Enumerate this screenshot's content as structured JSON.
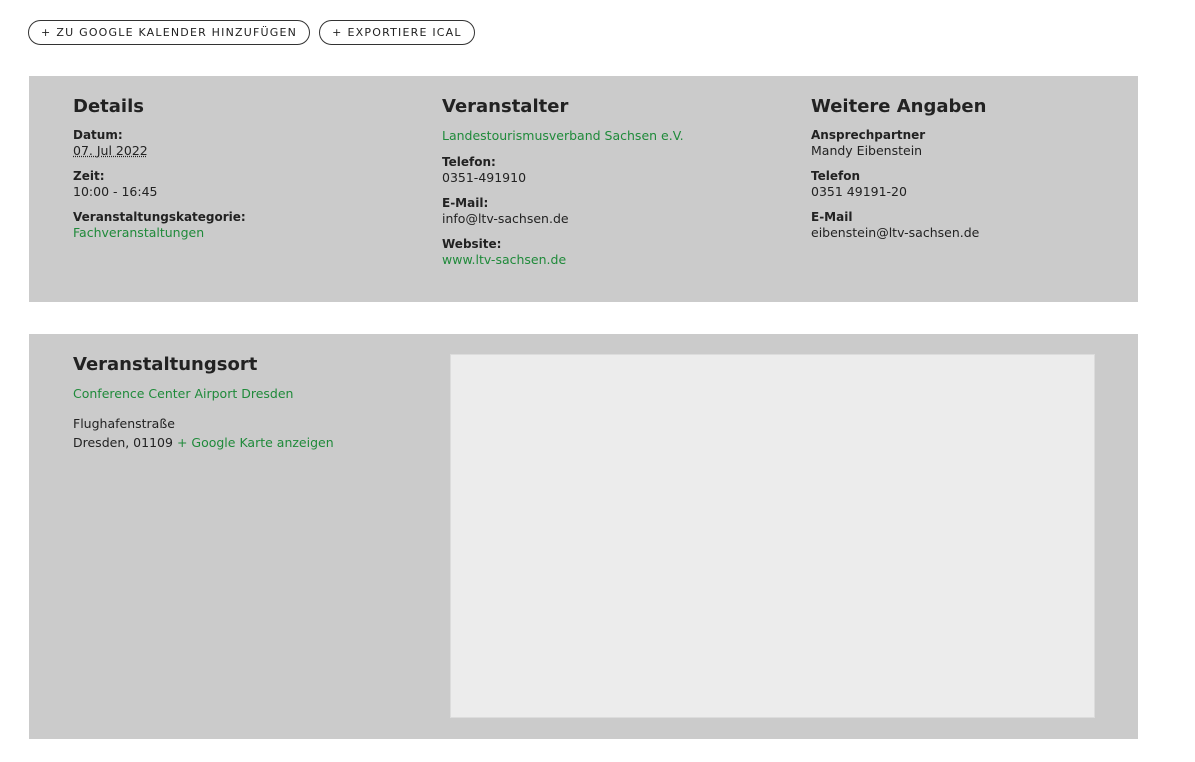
{
  "actions": {
    "google_calendar": "ZU GOOGLE KALENDER HINZUFÜGEN",
    "ical_export": "EXPORTIERE ICAL",
    "plus": "+"
  },
  "details": {
    "heading": "Details",
    "date_label": "Datum:",
    "date_value": "07. Jul 2022",
    "time_label": "Zeit:",
    "time_value": "10:00 - 16:45",
    "category_label": "Veranstaltungskategorie:",
    "category_value": "Fachveranstaltungen"
  },
  "organizer": {
    "heading": "Veranstalter",
    "name": "Landestourismusverband Sachsen e.V.",
    "phone_label": "Telefon:",
    "phone_value": "0351-491910",
    "email_label": "E-Mail:",
    "email_value": "info@ltv-sachsen.de",
    "website_label": "Website:",
    "website_value": "www.ltv-sachsen.de"
  },
  "more": {
    "heading": "Weitere Angaben",
    "contact_label": "Ansprechpartner",
    "contact_value": "Mandy Eibenstein",
    "phone_label": "Telefon",
    "phone_value": "0351 49191-20",
    "email_label": "E-Mail",
    "email_value": "eibenstein@ltv-sachsen.de"
  },
  "venue": {
    "heading": "Veranstaltungsort",
    "name": "Conference Center Airport Dresden",
    "street": "Flughafenstraße",
    "city_zip": "Dresden, 01109",
    "map_link": "+ Google Karte anzeigen"
  },
  "colors": {
    "panel": "#cbcbcb",
    "link": "#1f8a3a",
    "map_placeholder": "#ececec"
  }
}
